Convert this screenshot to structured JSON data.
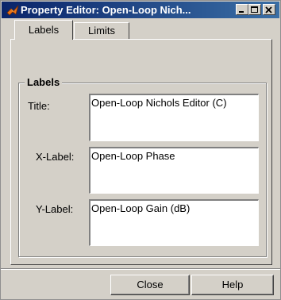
{
  "window": {
    "title": "Property Editor: Open-Loop Nich...",
    "title_icon": "matlab-icon",
    "controls": [
      "minimize-icon",
      "maximize-icon",
      "close-icon"
    ]
  },
  "tabs": [
    {
      "label": "Labels",
      "active": true
    },
    {
      "label": "Limits",
      "active": false
    }
  ],
  "group": {
    "legend": "Labels"
  },
  "fields": {
    "title": {
      "label": "Title:",
      "value": "Open-Loop Nichols Editor (C)"
    },
    "xlabel": {
      "label": "X-Label:",
      "value": "Open-Loop Phase"
    },
    "ylabel": {
      "label": "Y-Label:",
      "value": "Open-Loop Gain (dB)"
    }
  },
  "buttons": {
    "close": "Close",
    "help": "Help"
  },
  "colors": {
    "titlebar_start": "#0a246a",
    "titlebar_end": "#3a6ea5",
    "face": "#d4d0c8"
  }
}
